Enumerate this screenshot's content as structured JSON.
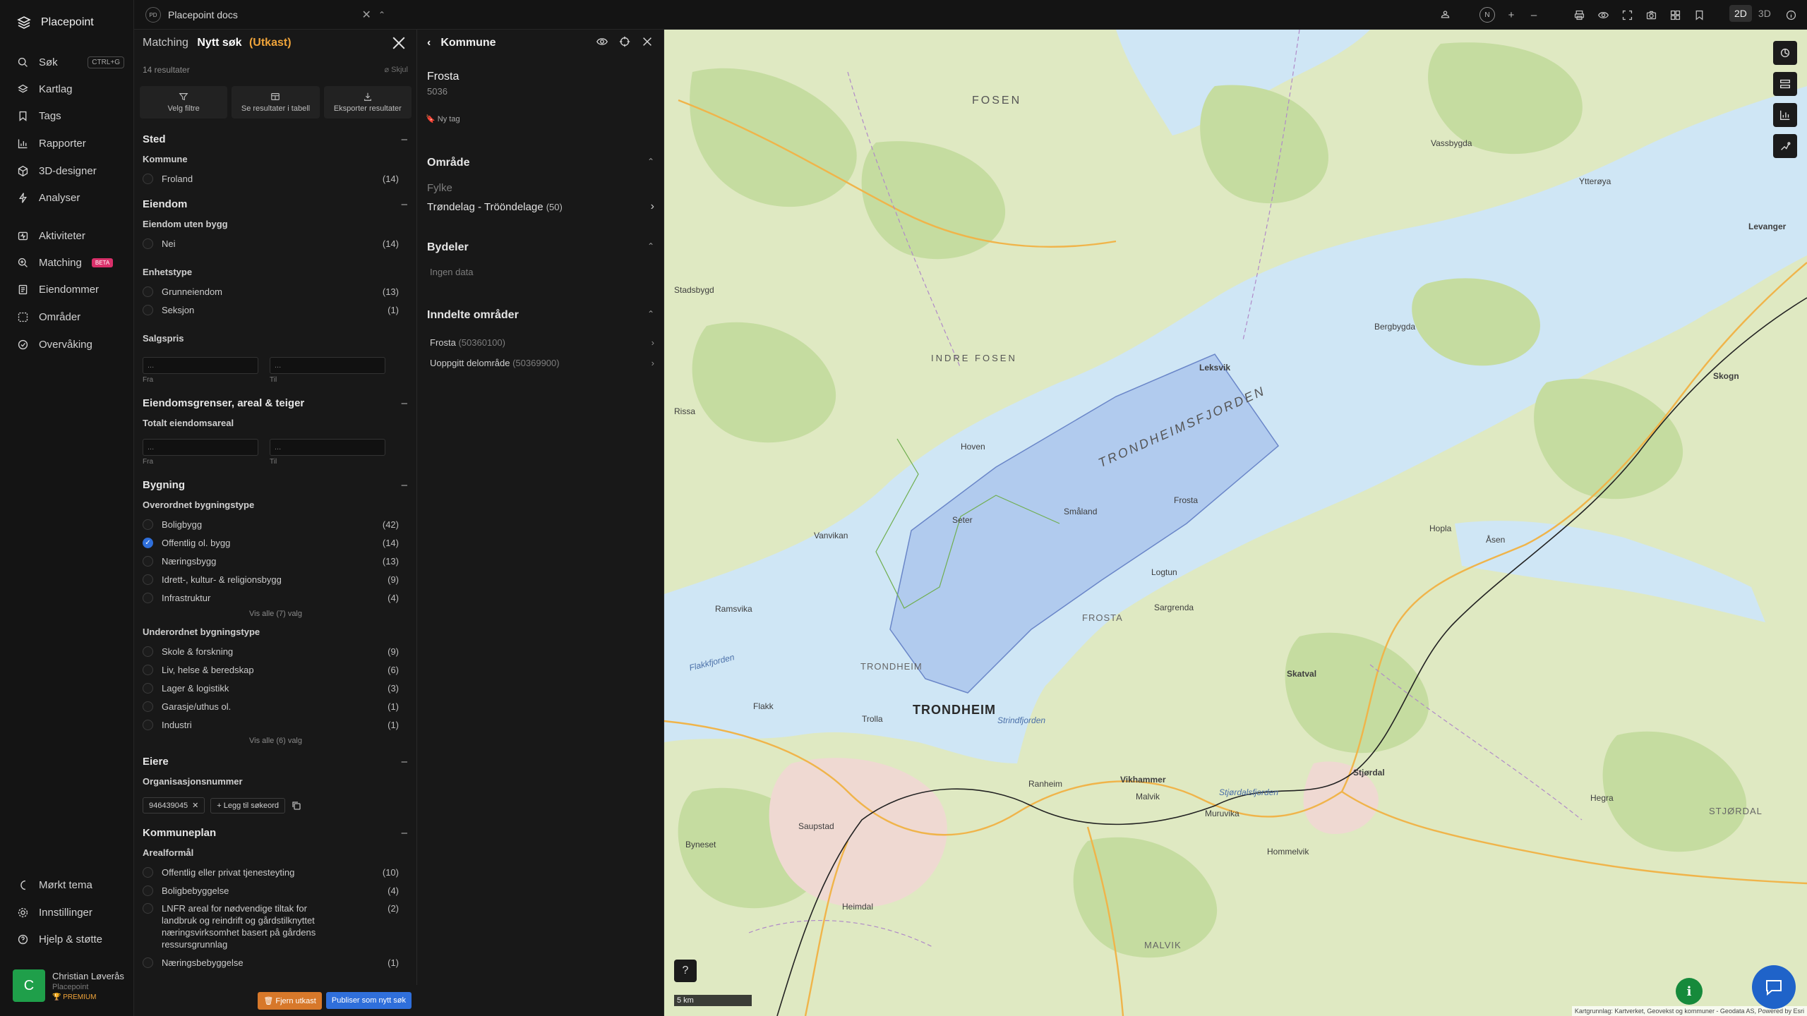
{
  "app": {
    "name": "Placepoint"
  },
  "nav": {
    "items": [
      {
        "label": "Søk",
        "shortcut": "CTRL+G"
      },
      {
        "label": "Kartlag"
      },
      {
        "label": "Tags"
      },
      {
        "label": "Rapporter"
      },
      {
        "label": "3D-designer"
      },
      {
        "label": "Analyser"
      },
      {
        "label": "Aktiviteter"
      },
      {
        "label": "Matching",
        "badge": "BETA"
      },
      {
        "label": "Eiendommer"
      },
      {
        "label": "Områder"
      },
      {
        "label": "Overvåking"
      }
    ],
    "bottom": [
      {
        "label": "Mørkt tema"
      },
      {
        "label": "Innstillinger"
      },
      {
        "label": "Hjelp & støtte"
      }
    ],
    "user": {
      "initial": "C",
      "name": "Christian Løverås",
      "org": "Placepoint",
      "plan": "PREMIUM"
    }
  },
  "workspace": {
    "badge": "PD",
    "name": "Placepoint docs"
  },
  "toolbar": {
    "compass": "N",
    "zoom_in": "+",
    "zoom_out": "–",
    "view_2d": "2D",
    "view_3d": "3D"
  },
  "search": {
    "breadcrumb_parent": "Matching",
    "title": "Nytt søk",
    "status": "(Utkast)",
    "result_count": "14 resultater",
    "hide_label": "Skjul",
    "actions": {
      "filter": "Velg filtre",
      "table": "Se resultater i tabell",
      "export": "Eksporter resultater"
    },
    "sections": {
      "sted": {
        "title": "Sted",
        "kommune": {
          "label": "Kommune",
          "options": [
            {
              "label": "Froland",
              "count": "(14)"
            }
          ]
        }
      },
      "eiendom": {
        "title": "Eiendom",
        "uten_bygg": {
          "label": "Eiendom uten bygg",
          "options": [
            {
              "label": "Nei",
              "count": "(14)"
            }
          ]
        },
        "enhetstype": {
          "label": "Enhetstype",
          "options": [
            {
              "label": "Grunneiendom",
              "count": "(13)"
            },
            {
              "label": "Seksjon",
              "count": "(1)"
            }
          ]
        },
        "salgspris": {
          "label": "Salgspris",
          "from_placeholder": "...",
          "to_placeholder": "...",
          "from": "Fra",
          "to": "Til"
        }
      },
      "grenser": {
        "title": "Eiendomsgrenser, areal & teiger",
        "areal": {
          "label": "Totalt eiendomsareal",
          "from_placeholder": "...",
          "to_placeholder": "...",
          "from": "Fra",
          "to": "Til"
        }
      },
      "bygning": {
        "title": "Bygning",
        "overordnet": {
          "label": "Overordnet bygningstype",
          "options": [
            {
              "label": "Boligbygg",
              "count": "(42)"
            },
            {
              "label": "Offentlig ol. bygg",
              "count": "(14)"
            },
            {
              "label": "Næringsbygg",
              "count": "(13)"
            },
            {
              "label": "Idrett-, kultur- & religionsbygg",
              "count": "(9)"
            },
            {
              "label": "Infrastruktur",
              "count": "(4)"
            }
          ],
          "more": "Vis alle (7) valg"
        },
        "underordnet": {
          "label": "Underordnet bygningstype",
          "options": [
            {
              "label": "Skole & forskning",
              "count": "(9)"
            },
            {
              "label": "Liv, helse & beredskap",
              "count": "(6)"
            },
            {
              "label": "Lager & logistikk",
              "count": "(3)"
            },
            {
              "label": "Garasje/uthus ol.",
              "count": "(1)"
            },
            {
              "label": "Industri",
              "count": "(1)"
            }
          ],
          "more": "Vis alle (6) valg"
        }
      },
      "eiere": {
        "title": "Eiere",
        "org": {
          "label": "Organisasjonsnummer",
          "tag": "946439045",
          "add": "+ Legg til søkeord"
        }
      },
      "kommuneplan": {
        "title": "Kommuneplan",
        "arealformal": {
          "label": "Arealformål",
          "options": [
            {
              "label": "Offentlig eller privat tjenesteyting",
              "count": "(10)"
            },
            {
              "label": "Boligbebyggelse",
              "count": "(4)"
            },
            {
              "label": "LNFR areal for nødvendige tiltak for landbruk og reindrift og gårdstilknyttet næringsvirksomhet basert på gårdens ressursgrunnlag",
              "count": "(2)"
            },
            {
              "label": "Næringsbebyggelse",
              "count": "(1)"
            }
          ]
        }
      }
    },
    "footer": {
      "remove": "Fjern utkast",
      "publish": "Publiser som nytt søk"
    }
  },
  "detail": {
    "title": "Kommune",
    "name": "Frosta",
    "code": "5036",
    "new_tag": "Ny tag",
    "omrade": {
      "title": "Område",
      "fylke_label": "Fylke",
      "fylke_value": "Trøndelag - Trööndelage",
      "fylke_count": "(50)"
    },
    "bydeler": {
      "title": "Bydeler",
      "empty": "Ingen data"
    },
    "inndelte": {
      "title": "Inndelte områder",
      "items": [
        {
          "label": "Frosta",
          "code": "(50360100)"
        },
        {
          "label": "Uoppgitt delområde",
          "code": "(50369900)"
        }
      ]
    }
  },
  "map": {
    "labels": [
      "FOSEN",
      "INDRE FOSEN",
      "TRONDHEIMSFJORDEN",
      "TRONDHEIM",
      "TRONDHEIM",
      "FROSTA",
      "STJØRDAL",
      "MALVIK",
      "Leksvik",
      "Levanger",
      "Skogn",
      "Vikhammer",
      "Stjørdal",
      "Rissa",
      "Vanvikan",
      "Seter",
      "Stadsbygd",
      "Hommelvik",
      "Muruvika",
      "Ranheim",
      "Strindfjorden",
      "Stjørdalsfjorden",
      "Åsen",
      "Hoplа",
      "Byneset",
      "Flakk",
      "Trolla",
      "Heimdal",
      "Malvik",
      "Skatval",
      "Frosta",
      "Logtun",
      "Småland",
      "Ytterøya",
      "Hoven",
      "Flakkfjorden",
      "Sargrenda",
      "Ramsvika",
      "Vassbygda",
      "Bergbygda",
      "Hegra",
      "Saupstad"
    ],
    "scale": "5 km",
    "attribution": "Kartgrunnlag: Kartverket, Geovekst og kommuner - Geodata AS, Powered by Esri",
    "help": "?",
    "info": "i"
  }
}
